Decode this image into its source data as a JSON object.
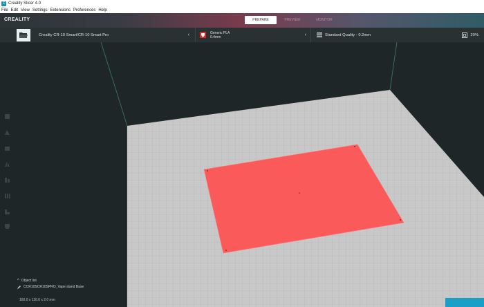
{
  "app": {
    "title": "Creality Slicer 4.0",
    "logo": "CREALITY"
  },
  "menu": [
    "File",
    "Edit",
    "View",
    "Settings",
    "Extensions",
    "Preferences",
    "Help"
  ],
  "stages": [
    {
      "label": "PREPARE",
      "active": true
    },
    {
      "label": "PREVIEW",
      "active": false
    },
    {
      "label": "MONITOR",
      "active": false
    }
  ],
  "printer": {
    "name": "Creality CR-10 Smart/CR-10 Smart Pro"
  },
  "material": {
    "name": "Generic PLA",
    "nozzle": "0.4mm",
    "color": "#d52b2b"
  },
  "quality": {
    "profile": "Standard Quality - 0.2mm",
    "infill": "20%"
  },
  "object": {
    "list_label": "Object list",
    "file_name": "CCR10SCR10SPRO_Vape stand Base",
    "dimensions": "160.0 x 116.0 x 2.0 mm"
  },
  "colors": {
    "accent": "#1aa0c7",
    "model": "#fa5a5a",
    "bed": "#c8c8c8"
  },
  "icons": [
    "folder-icon",
    "chevron-left-icon",
    "quality-icon",
    "infill-icon",
    "chevron-up-icon",
    "edit-pencil-icon",
    "move-tool-icon",
    "scale-tool-icon",
    "rotate-tool-icon",
    "mirror-tool-icon",
    "per-model-settings-icon",
    "support-blocker-icon",
    "tree-support-icon",
    "lay-flat-icon",
    "cube-icon"
  ]
}
